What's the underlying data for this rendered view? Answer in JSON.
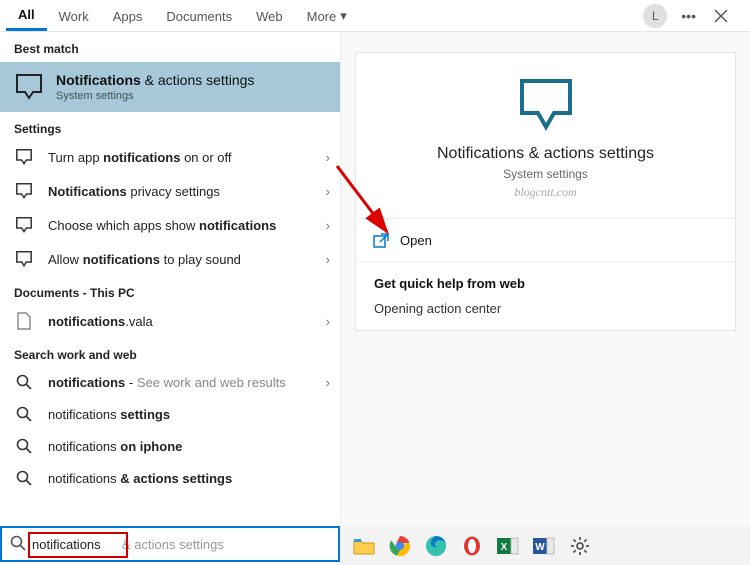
{
  "tabs": {
    "all": "All",
    "work": "Work",
    "apps": "Apps",
    "documents": "Documents",
    "web": "Web",
    "more": "More"
  },
  "top": {
    "avatar_initial": "L"
  },
  "sections": {
    "best_match": "Best match",
    "settings": "Settings",
    "documents_pc": "Documents - This PC",
    "search_web": "Search work and web"
  },
  "best_match": {
    "title_prefix": "Notifications",
    "title_rest": " & actions settings",
    "subtitle": "System settings"
  },
  "settings_rows": [
    {
      "pre": "Turn app ",
      "bold": "notifications",
      "post": " on or off"
    },
    {
      "pre": "",
      "bold": "Notifications",
      "post": " privacy settings"
    },
    {
      "pre": "Choose which apps show ",
      "bold": "notifications",
      "post": ""
    },
    {
      "pre": "Allow ",
      "bold": "notifications",
      "post": " to play sound"
    }
  ],
  "documents_rows": [
    {
      "bold": "notifications",
      "post": ".vala"
    }
  ],
  "web_rows": [
    {
      "bold": "notifications",
      "post": " - ",
      "hint": "See work and web results"
    },
    {
      "pre": "notifications ",
      "bold": "settings",
      "post": ""
    },
    {
      "pre": "notifications ",
      "bold": "on iphone",
      "post": ""
    },
    {
      "pre": "notifications ",
      "bold": "& actions settings",
      "post": ""
    }
  ],
  "preview": {
    "title": "Notifications & actions settings",
    "subtitle": "System settings",
    "watermark": "blogcntt.com",
    "open": "Open",
    "help_title": "Get quick help from web",
    "help_link": "Opening action center"
  },
  "search": {
    "value": "notifications",
    "ghost": " & actions settings"
  }
}
